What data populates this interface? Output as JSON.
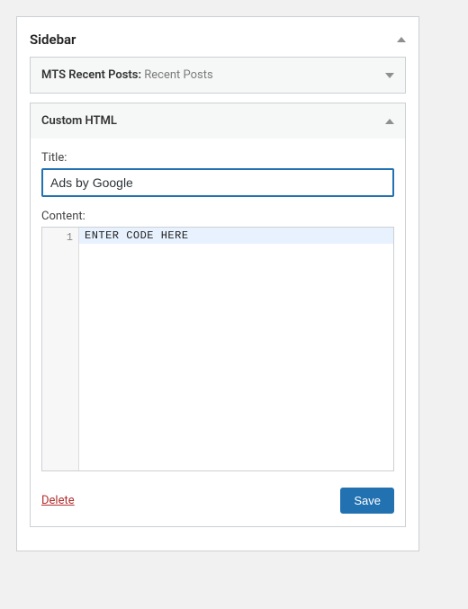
{
  "sidebar": {
    "title": "Sidebar"
  },
  "widgets": {
    "recent": {
      "name": "MTS Recent Posts:",
      "sub": "Recent Posts"
    },
    "customHtml": {
      "name": "Custom HTML",
      "fields": {
        "titleLabel": "Title:",
        "titleValue": "Ads by Google",
        "contentLabel": "Content:",
        "lineNumber": "1",
        "codeLine": "ENTER CODE HERE"
      },
      "actions": {
        "delete": "Delete",
        "save": "Save"
      }
    }
  }
}
